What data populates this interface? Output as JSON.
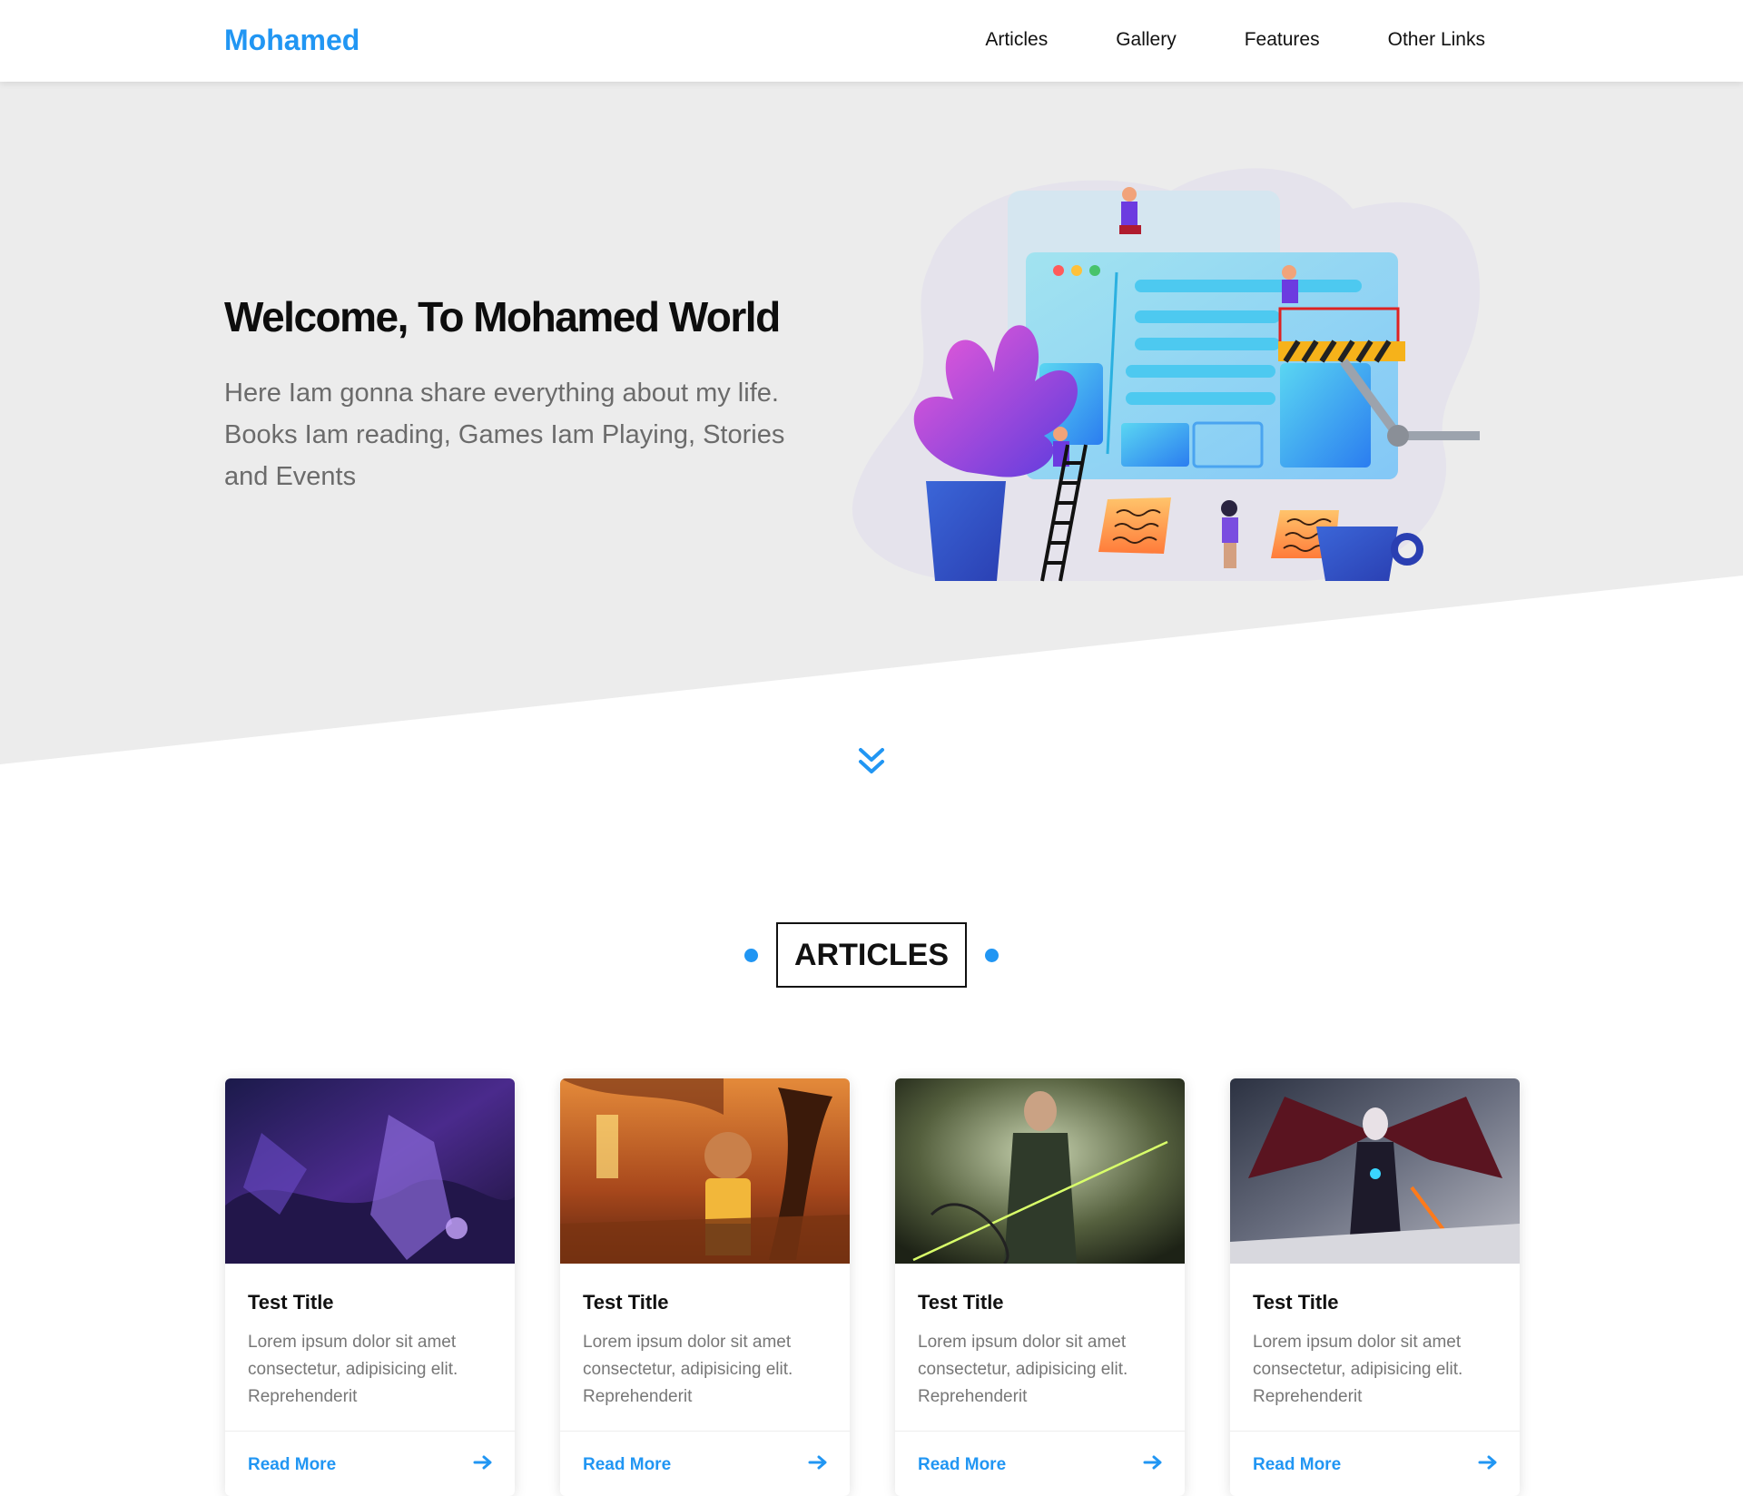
{
  "header": {
    "logo": "Mohamed",
    "nav": [
      "Articles",
      "Gallery",
      "Features",
      "Other Links"
    ]
  },
  "hero": {
    "title": "Welcome, To Mohamed World",
    "text": "Here Iam gonna share everything about my life. Books Iam reading, Games Iam Playing, Stories and Events",
    "illustration_icon": "website-construction-illustration"
  },
  "articles": {
    "heading": "ARTICLES",
    "cards": [
      {
        "title": "Test Title",
        "text": "Lorem ipsum dolor sit amet consectetur, adipisicing elit. Reprehenderit",
        "link": "Read More"
      },
      {
        "title": "Test Title",
        "text": "Lorem ipsum dolor sit amet consectetur, adipisicing elit. Reprehenderit",
        "link": "Read More"
      },
      {
        "title": "Test Title",
        "text": "Lorem ipsum dolor sit amet consectetur, adipisicing elit. Reprehenderit",
        "link": "Read More"
      },
      {
        "title": "Test Title",
        "text": "Lorem ipsum dolor sit amet consectetur, adipisicing elit. Reprehenderit",
        "link": "Read More"
      }
    ]
  },
  "colors": {
    "accent": "#2196f3",
    "hero_bg": "#ececec",
    "text_dark": "#111111",
    "text_muted": "#777777"
  }
}
